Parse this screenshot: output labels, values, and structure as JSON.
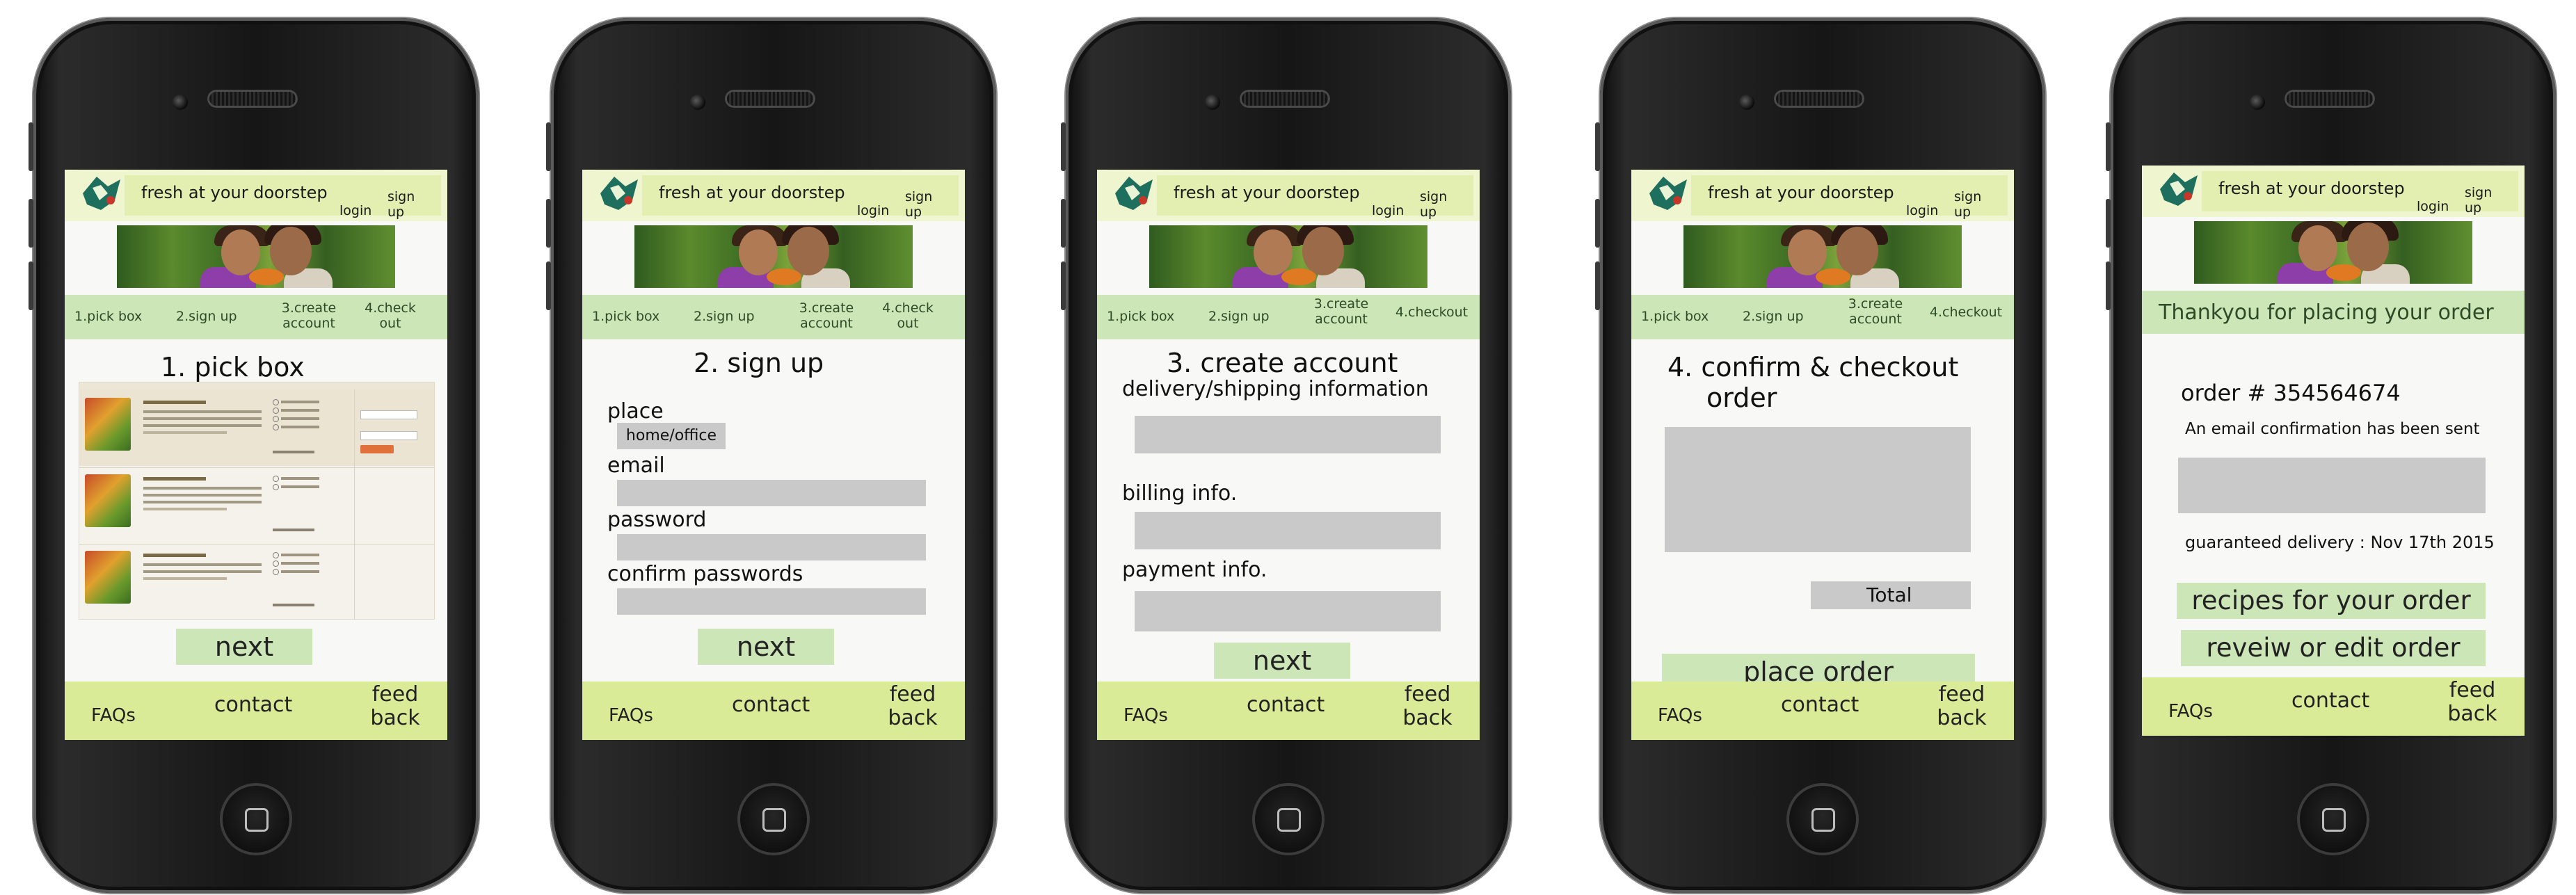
{
  "common": {
    "tagline": "fresh at your doorstep",
    "login": "login",
    "signup": "sign up",
    "footer": {
      "faqs": "FAQs",
      "contact": "contact",
      "feedback": "feed back"
    }
  },
  "screen1": {
    "steps": [
      "1.pick box",
      "2.sign up",
      "3.create account",
      "4.check out"
    ],
    "heading": "1. pick box",
    "next": "next"
  },
  "screen2": {
    "steps": [
      "1.pick box",
      "2.sign up",
      "3.create account",
      "4.check out"
    ],
    "heading": "2. sign up",
    "place_label": "place",
    "place_value": "home/office",
    "email_label": "email",
    "password_label": "password",
    "confirm_label": "confirm passwords",
    "next": "next"
  },
  "screen3": {
    "steps": [
      "1.pick box",
      "2.sign up",
      "3.create account",
      "4.checkout"
    ],
    "heading": "3. create account",
    "delivery_label": "delivery/shipping information",
    "billing_label": "billing info.",
    "payment_label": "payment info.",
    "next": "next"
  },
  "screen4": {
    "steps": [
      "1.pick box",
      "2.sign up",
      "3.create account",
      "4.checkout"
    ],
    "heading_line1": "4. confirm & checkout",
    "heading_line2": "order",
    "total": "Total",
    "place_order": "place order"
  },
  "screen5": {
    "thanks": "Thankyou for placing your order",
    "order_number": "order # 354564674",
    "email_confirm": "An email confirmation has been sent",
    "delivery": "guaranteed delivery : Nov 17th 2015",
    "recipes": "recipes for your order",
    "review": "reveiw or edit order"
  }
}
